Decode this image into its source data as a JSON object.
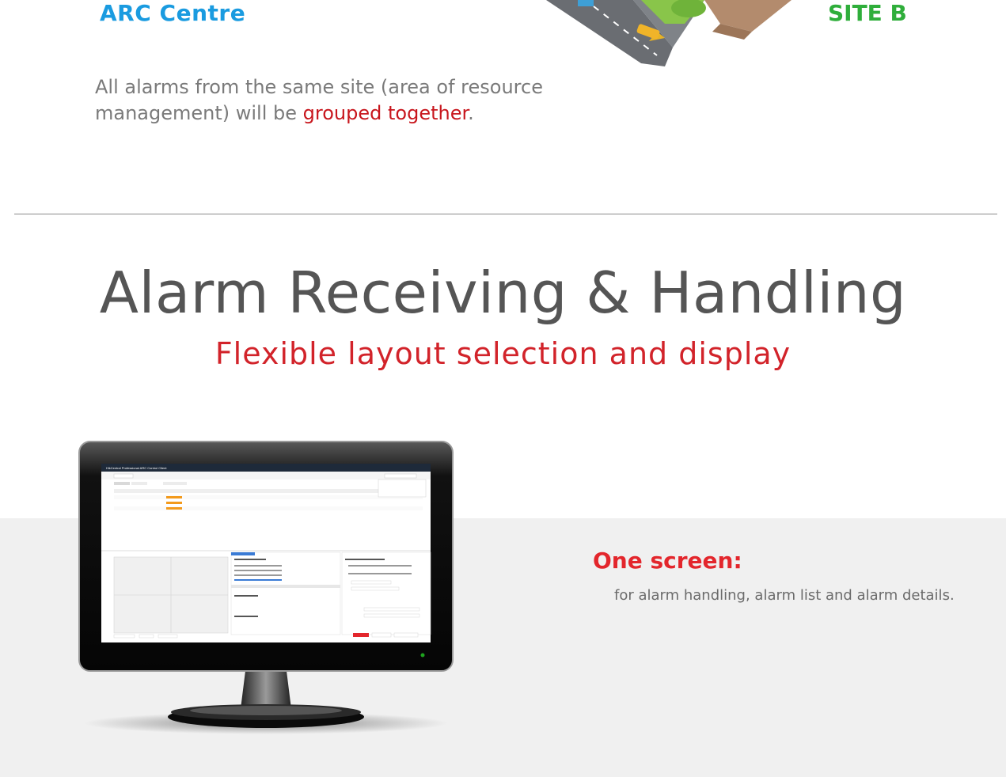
{
  "top": {
    "arc_label": "ARC Centre",
    "site_b_label": "SITE B",
    "intro_part1": "All alarms from the same site (area of resource management) will be ",
    "intro_highlight": "grouped together",
    "intro_end": "."
  },
  "section": {
    "title": "Alarm Receiving & Handling",
    "subtitle": "Flexible layout selection and display"
  },
  "feature": {
    "heading": "One screen:",
    "description": "for alarm handling, alarm list and alarm details."
  },
  "screen": {
    "window_title": "HikCentral Professional ARC Control Client",
    "button_label": "Acknowledge"
  },
  "colors": {
    "arc_blue": "#1a9be0",
    "site_green": "#2fae3b",
    "accent_red": "#d2232a",
    "title_gray": "#555555"
  }
}
